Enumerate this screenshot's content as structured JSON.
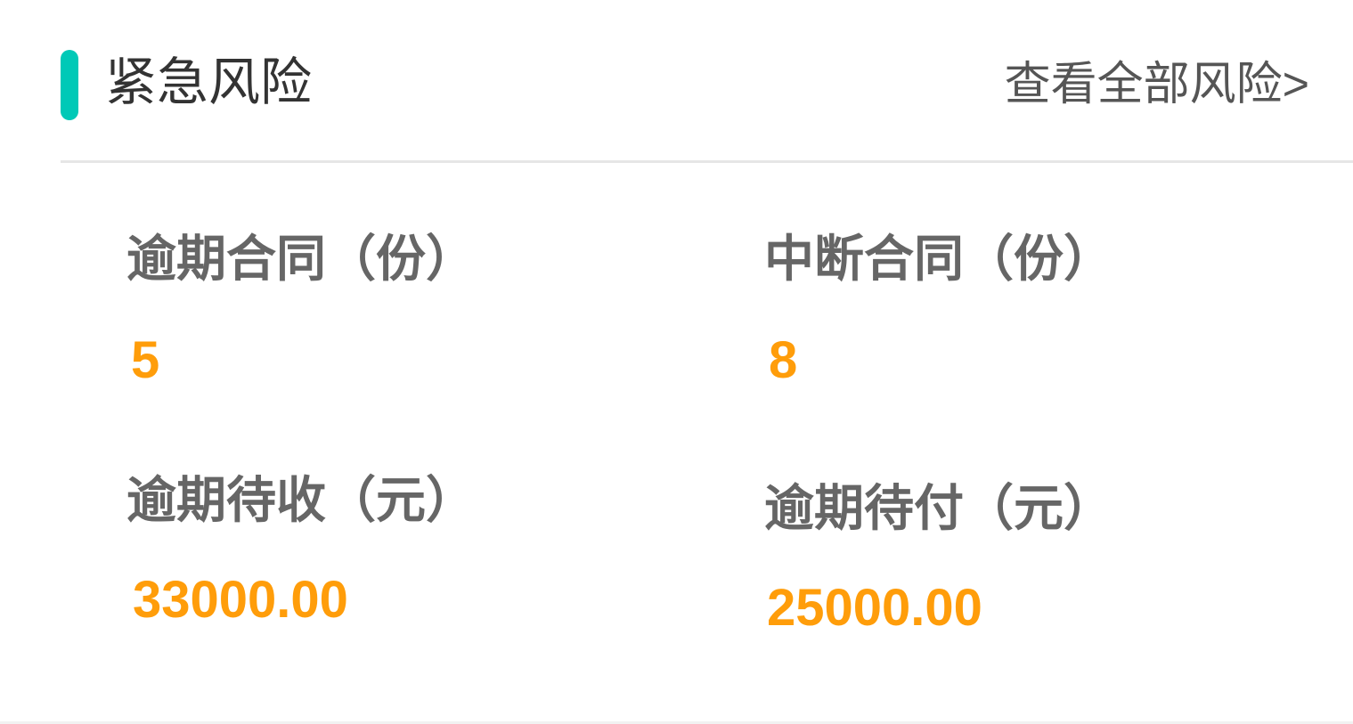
{
  "colors": {
    "accent": "#00c9b7",
    "value": "#ff9d0a"
  },
  "header": {
    "title": "紧急风险",
    "view_all_label": "查看全部风险>"
  },
  "stats": [
    {
      "label": "逾期合同（份）",
      "value": "5"
    },
    {
      "label": "中断合同（份）",
      "value": "8"
    },
    {
      "label": "逾期待收（元）",
      "value": "33000.00"
    },
    {
      "label": "逾期待付（元）",
      "value": "25000.00"
    }
  ]
}
